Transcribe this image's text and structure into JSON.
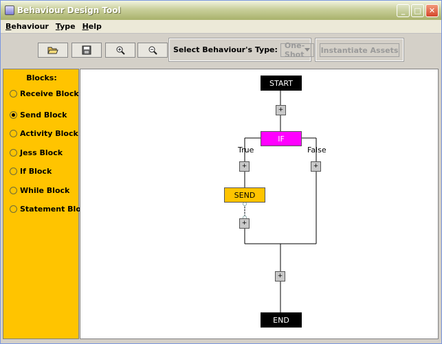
{
  "window": {
    "title": "Behaviour Design Tool",
    "minimize": "_",
    "maximize": "□",
    "close": "✕"
  },
  "menu": [
    "Behaviour",
    "Type",
    "Help"
  ],
  "toolbar": {
    "buttons": [
      "open-folder-icon",
      "save-disk-icon",
      "zoom-in-icon",
      "zoom-out-icon"
    ],
    "type_label": "Select Behaviour's Type:",
    "type_value": "One-Shot",
    "assets_label": "Instantiate Assets"
  },
  "sidebar": {
    "title": "Blocks:",
    "items": [
      {
        "label": "Receive Block",
        "checked": false
      },
      {
        "label": "Send Block",
        "checked": true
      },
      {
        "label": "Activity Block",
        "checked": false
      },
      {
        "label": "Jess Block",
        "checked": false
      },
      {
        "label": "If Block",
        "checked": false
      },
      {
        "label": "While Block",
        "checked": false
      },
      {
        "label": "Statement Blo...",
        "checked": false
      }
    ]
  },
  "canvas": {
    "start": "START",
    "if": "IF",
    "true_label": "True",
    "false_label": "False",
    "send": "SEND",
    "end": "END",
    "plus": "+",
    "colors": {
      "if": "#ff00ff",
      "send": "#ffc400",
      "terminal": "#000000"
    }
  }
}
